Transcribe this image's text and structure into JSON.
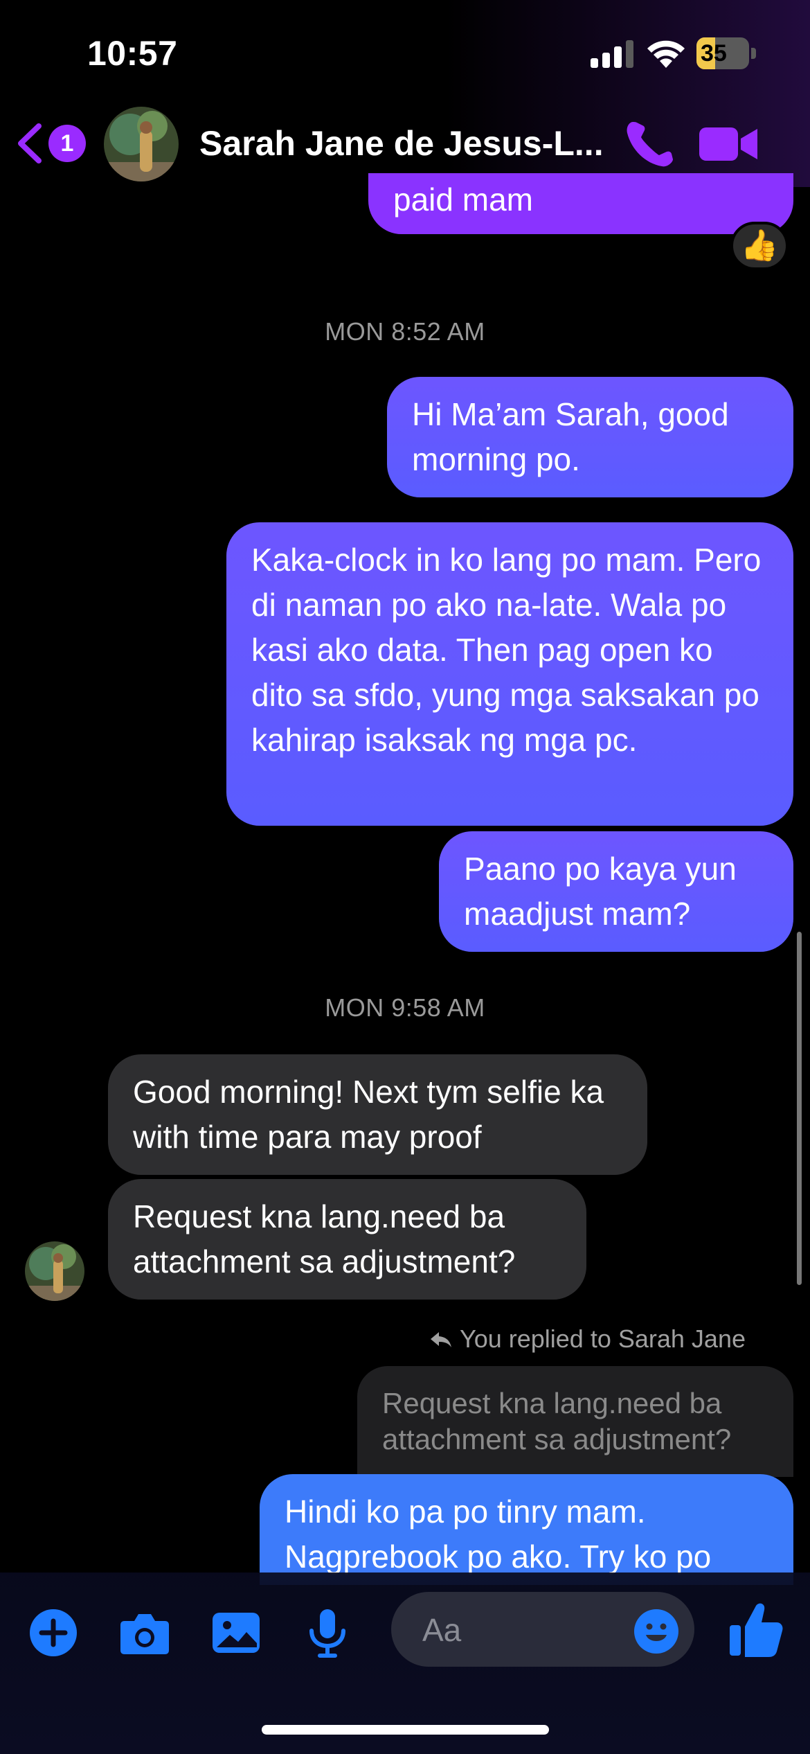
{
  "status_bar": {
    "time": "10:57",
    "battery_level": "35",
    "battery_fill_pct": 35
  },
  "header": {
    "unread_count": "1",
    "contact_name": "Sarah Jane de Jesus-L...",
    "accent_color": "#9a2bff"
  },
  "messages": {
    "partial_outgoing": "paid mam",
    "reaction": "👍",
    "timestamp_1": "MON 8:52 AM",
    "out_1": "Hi Ma’am Sarah, good morning po.",
    "out_2": "Kaka-clock in ko lang po mam. Pero di naman po ako na-late. Wala po kasi ako data. Then pag open ko dito sa sfdo, yung mga saksakan po kahirap isaksak ng mga pc.",
    "out_3": "Paano po kaya yun maadjust mam?",
    "timestamp_2": "MON 9:58 AM",
    "in_1": "Good morning! Next tym selfie ka with time para may proof",
    "in_2": "Request kna lang.need ba attachment sa adjustment?",
    "reply_context": "You replied to Sarah Jane",
    "quoted": "Request kna lang.need ba attachment sa adjustment?",
    "reply": "Hindi ko pa po tinry mam. Nagprebook po ako. Try ko po"
  },
  "composer": {
    "placeholder": "Aa",
    "icons": [
      "plus-icon",
      "camera-icon",
      "gallery-icon",
      "microphone-icon",
      "emoji-icon",
      "thumbs-up-icon"
    ],
    "icon_color": "#1e7bff"
  }
}
